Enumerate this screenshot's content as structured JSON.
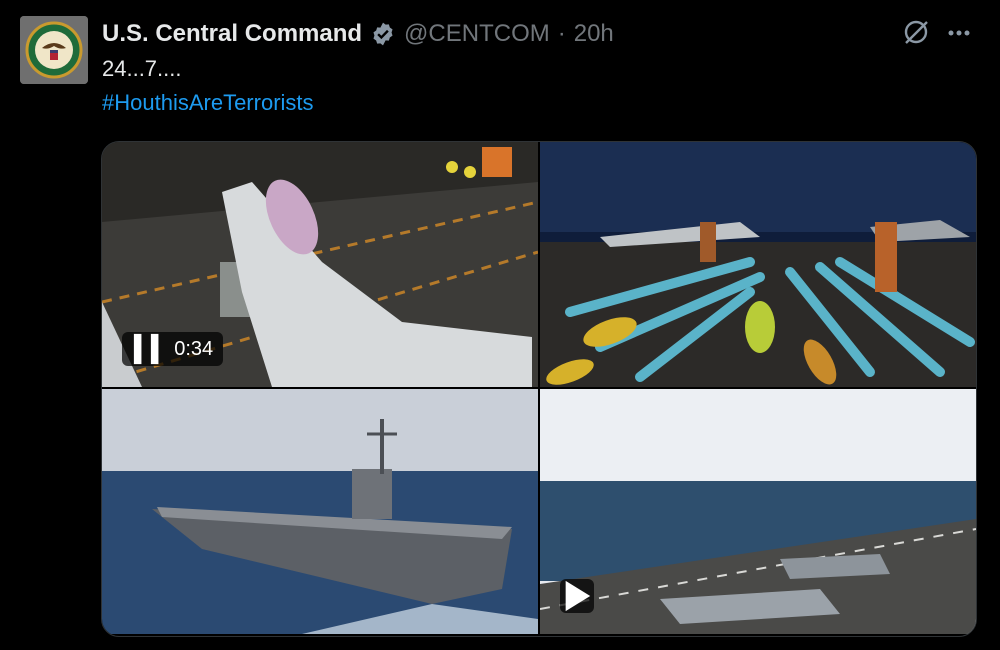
{
  "post": {
    "author_name": "U.S. Central Command",
    "handle": "@CENTCOM",
    "separator": "·",
    "time": "20h",
    "text": "24...7....",
    "hashtag": "#HouthisAreTerrorists"
  },
  "media": {
    "video_duration": "0:34",
    "items": [
      "fighter-jet-on-flight-deck",
      "munitions-at-night",
      "aircraft-carrier-at-sea",
      "carrier-deck-at-sea"
    ]
  },
  "icons": [
    "verified-badge-icon",
    "grok-icon",
    "more-icon",
    "pause-icon",
    "play-icon"
  ],
  "colors": {
    "background": "#000000",
    "text": "#e7e9ea",
    "muted": "#71767b",
    "link": "#1d9bf0"
  }
}
